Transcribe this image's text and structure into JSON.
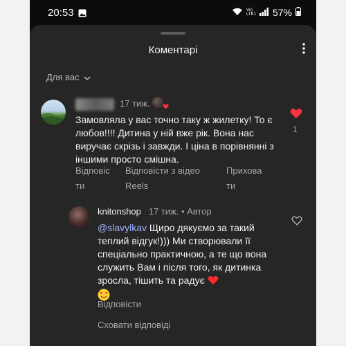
{
  "statusbar": {
    "time": "20:53",
    "network": "Vo) LTE1",
    "battery": "57%"
  },
  "sheet": {
    "title": "Коментарі",
    "filter_label": "Для вас"
  },
  "comment": {
    "meta": "17 тиж.",
    "text": "Замовляла у вас точно таку ж жилетку! То є любов!!!! Дитина у ній вже рік. Вона нас виручає скрізь і завжди. І ціна в порівнянні з іншими просто смішна.",
    "likes": "1",
    "actions": {
      "reply_a": "Відповіс",
      "reply_b": "ти",
      "reels_a": "Відповісти з відео",
      "reels_b": "Reels",
      "hide_a": "Прихова",
      "hide_b": "ти"
    }
  },
  "reply": {
    "username": "knitonshop",
    "meta": "17 тиж. • Автор",
    "mention": "@slavylkav",
    "text": "Щиро дякуємо за такий теплий відгук!))) Ми створювали її спеціально практичною, а те що вона служить Вам і після того, як дитинка зросла, тішить та радує",
    "reply_label": "Відповісти"
  },
  "hide_replies_label": "Сховати відповіді",
  "colors": {
    "sheet_bg": "#262626",
    "text": "#f2f2f2",
    "secondary": "#a8a8a8",
    "like_red": "#ff3040",
    "mention": "#9fb2ff"
  }
}
